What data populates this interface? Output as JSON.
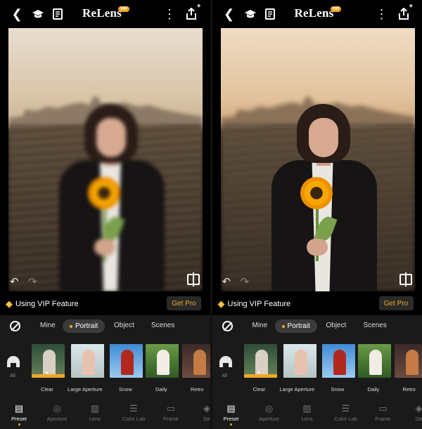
{
  "app": {
    "name": "ReLens",
    "vip_badge": "VIP"
  },
  "colors": {
    "accent": "#f5a623",
    "sheet_bg": "#1a1a1a",
    "page_bg": "#000000"
  },
  "icons": [
    "back-icon",
    "tutorial-cap-icon",
    "bookmark-icon",
    "more-icon",
    "share-icon",
    "undo-icon",
    "redo-icon",
    "compare-icon",
    "vip-diamond-icon",
    "none-icon",
    "all-presets-icon",
    "preset-icon",
    "aperture-icon",
    "lens-icon",
    "color-lab-icon",
    "frame-icon"
  ],
  "panels": [
    {
      "vip_text": "Using VIP Feature",
      "get_pro": "Get Pro",
      "categories": [
        "Mine",
        "Portrait",
        "Object",
        "Scenes"
      ],
      "active_category": "Portrait",
      "all_label": "All",
      "presets": [
        "Clear",
        "Large Aperture",
        "Snow",
        "Daily",
        "Retro"
      ],
      "selected_preset": "Clear",
      "nav": [
        "Preset",
        "Aperture",
        "Lens",
        "Color Lab",
        "Frame",
        "De"
      ]
    },
    {
      "vip_text": "Using VIP Feature",
      "get_pro": "Get Pro",
      "categories": [
        "Mine",
        "Portrait",
        "Object",
        "Scenes"
      ],
      "active_category": "Portrait",
      "all_label": "All",
      "presets": [
        "Clear",
        "Large Aperture",
        "Snow",
        "Daily",
        "Retro"
      ],
      "selected_preset": "Clear",
      "nav": [
        "Preset",
        "Aperture",
        "Lens",
        "Color Lab",
        "Frame",
        "De"
      ]
    }
  ]
}
